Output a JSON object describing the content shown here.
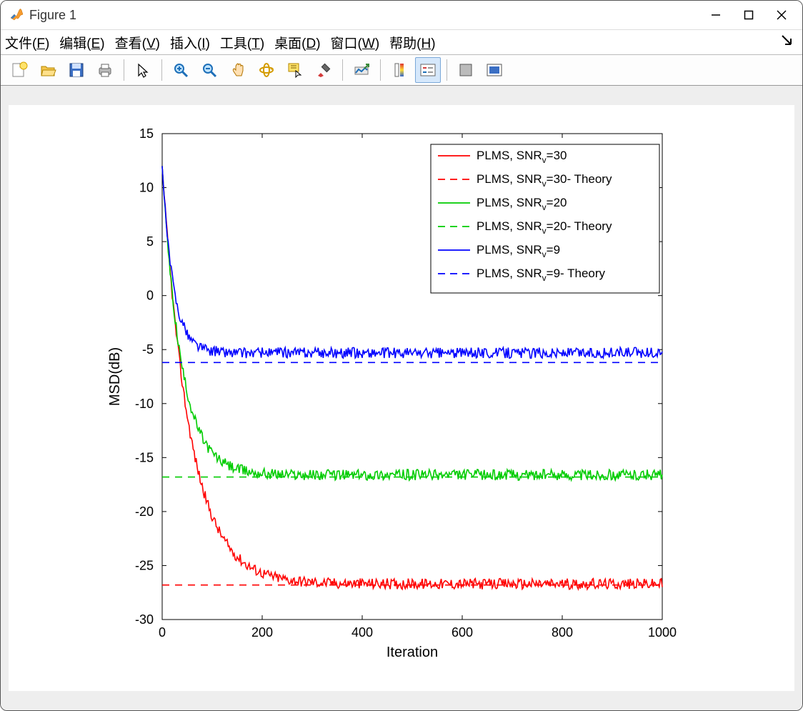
{
  "window": {
    "title": "Figure 1"
  },
  "menubar": {
    "items": [
      {
        "label": "文件",
        "accel": "F"
      },
      {
        "label": "编辑",
        "accel": "E"
      },
      {
        "label": "查看",
        "accel": "V"
      },
      {
        "label": "插入",
        "accel": "I"
      },
      {
        "label": "工具",
        "accel": "T"
      },
      {
        "label": "桌面",
        "accel": "D"
      },
      {
        "label": "窗口",
        "accel": "W"
      },
      {
        "label": "帮助",
        "accel": "H"
      }
    ]
  },
  "toolbar": {
    "buttons": [
      {
        "id": "new",
        "name": "new-figure-icon"
      },
      {
        "id": "open",
        "name": "open-icon"
      },
      {
        "id": "save",
        "name": "save-icon"
      },
      {
        "id": "print",
        "name": "print-icon"
      },
      {
        "sep": true
      },
      {
        "id": "pointer",
        "name": "pointer-icon"
      },
      {
        "sep": true
      },
      {
        "id": "zoom-in",
        "name": "zoom-in-icon"
      },
      {
        "id": "zoom-out",
        "name": "zoom-out-icon"
      },
      {
        "id": "pan",
        "name": "pan-icon"
      },
      {
        "id": "rotate3d",
        "name": "rotate3d-icon"
      },
      {
        "id": "datacursor",
        "name": "datacursor-icon"
      },
      {
        "id": "brush",
        "name": "brush-icon"
      },
      {
        "sep": true
      },
      {
        "id": "link",
        "name": "link-plot-icon"
      },
      {
        "sep": true
      },
      {
        "id": "colorbar",
        "name": "colorbar-icon"
      },
      {
        "id": "legend",
        "name": "legend-icon",
        "active": true
      },
      {
        "sep": true
      },
      {
        "id": "hideplot",
        "name": "hide-plot-icon"
      },
      {
        "id": "showplot",
        "name": "show-plot-icon"
      }
    ]
  },
  "chart_data": {
    "type": "line",
    "xlabel": "Iteration",
    "ylabel": "MSD(dB)",
    "xlim": [
      0,
      1000
    ],
    "ylim": [
      -30,
      15
    ],
    "xticks": [
      0,
      200,
      400,
      600,
      800,
      1000
    ],
    "yticks": [
      -30,
      -25,
      -20,
      -15,
      -10,
      -5,
      0,
      5,
      10,
      15
    ],
    "legend": {
      "position": "northeast"
    },
    "series": [
      {
        "name": "PLMS, SNR_v=30",
        "color": "#ff0000",
        "style": "solid",
        "kind": "sim",
        "settle_to": -26.7,
        "tau": 55,
        "noise": 0.5
      },
      {
        "name": "PLMS, SNR_v=30- Theory",
        "color": "#ff0000",
        "style": "dash",
        "kind": "theory",
        "value": -26.8
      },
      {
        "name": "PLMS, SNR_v=20",
        "color": "#00cc00",
        "style": "solid",
        "kind": "sim",
        "settle_to": -16.6,
        "tau": 38,
        "noise": 0.5
      },
      {
        "name": "PLMS, SNR_v=20- Theory",
        "color": "#00cc00",
        "style": "dash",
        "kind": "theory",
        "value": -16.8
      },
      {
        "name": "PLMS, SNR_v=9",
        "color": "#0000ff",
        "style": "solid",
        "kind": "sim",
        "settle_to": -5.3,
        "tau": 22,
        "noise": 0.5
      },
      {
        "name": "PLMS, SNR_v=9- Theory",
        "color": "#0000ff",
        "style": "dash",
        "kind": "theory",
        "value": -6.2
      }
    ],
    "start_value": 12
  }
}
